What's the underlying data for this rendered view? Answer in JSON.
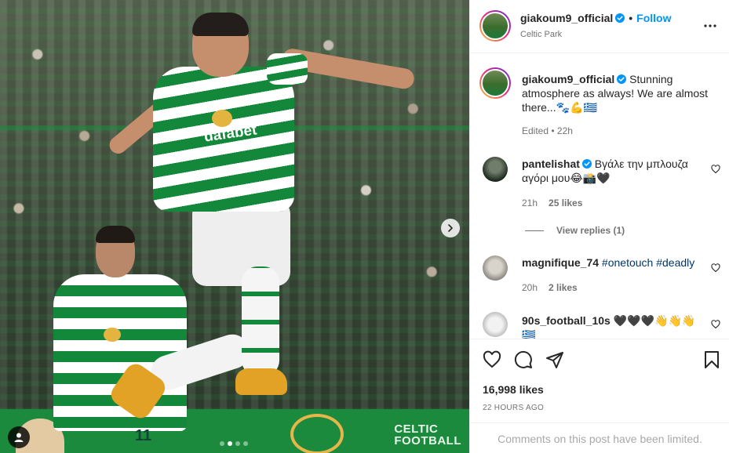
{
  "post": {
    "username": "giakoum9_official",
    "follow_label": "Follow",
    "separator": "•",
    "location": "Celtic Park",
    "caption_text": "Stunning atmosphere as always! We are almost there...🐾💪🇬🇷",
    "edited": "Edited • 22h",
    "likes": "16,998 likes",
    "time_ago": "22 HOURS AGO",
    "comments_limited": "Comments on this post have been limited."
  },
  "media": {
    "board_text_line1": "CELTIC",
    "board_text_line2": "FOOTBALL",
    "sponsor_text": "dafabet",
    "player_number": "11",
    "carousel_count": 4,
    "carousel_active_index": 1
  },
  "comments": [
    {
      "username": "pantelishat",
      "verified": true,
      "text": "Βγάλε την μπλουζα αγόρι μου😂📸🖤",
      "time": "21h",
      "likes": "25 likes",
      "view_replies": "View replies (1)"
    },
    {
      "username": "magnifique_74",
      "verified": false,
      "text_hashtags": "#onetouch #deadly",
      "time": "20h",
      "likes": "2 likes"
    },
    {
      "username": "90s_football_10s",
      "verified": false,
      "text": "🖤🖤🖤👋👋👋🇬🇷"
    }
  ],
  "colors": {
    "follow_blue": "#0095f6",
    "verified_blue": "#0095f6",
    "hashtag_blue": "#00376b",
    "celtic_green": "#14883a"
  },
  "icons": [
    "more-options-icon",
    "verified-badge-icon",
    "heart-icon",
    "comment-icon",
    "share-icon",
    "bookmark-icon",
    "chevron-right-icon",
    "user-tag-icon"
  ]
}
